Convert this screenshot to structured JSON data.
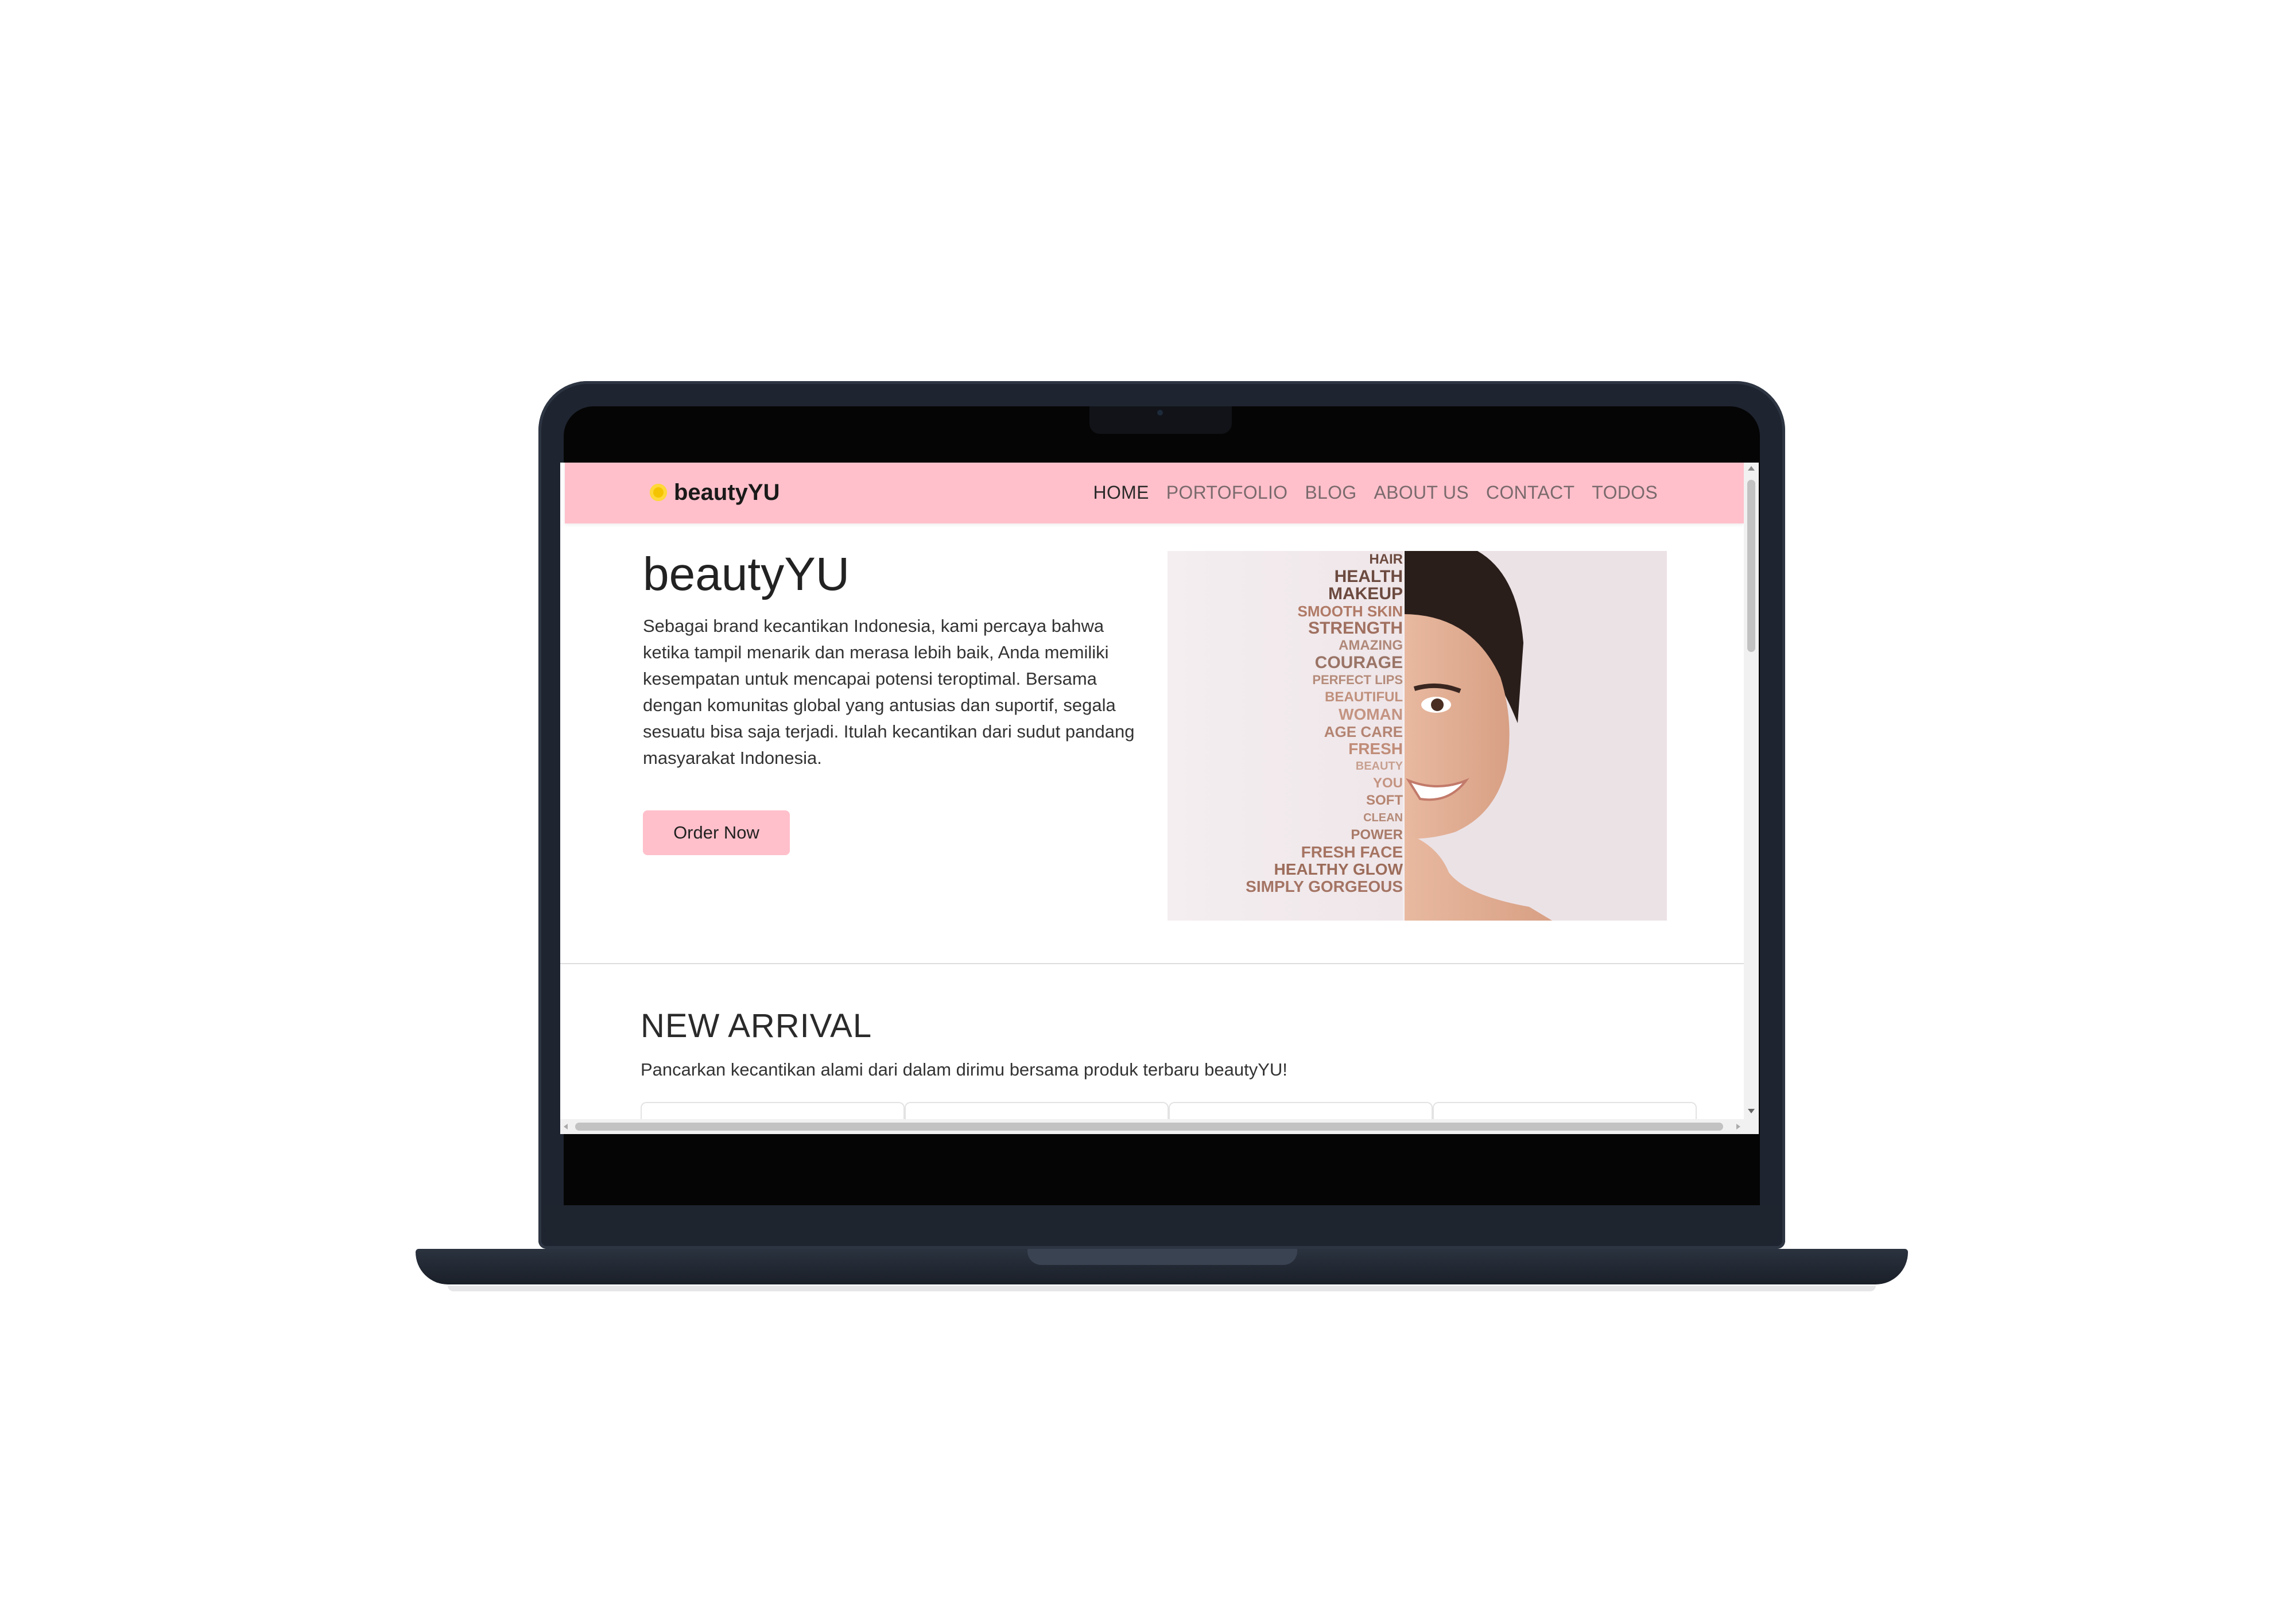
{
  "navbar": {
    "brand": "beautyYU",
    "items": [
      {
        "label": "HOME",
        "active": true
      },
      {
        "label": "PORTOFOLIO",
        "active": false
      },
      {
        "label": "BLOG",
        "active": false
      },
      {
        "label": "ABOUT US",
        "active": false
      },
      {
        "label": "CONTACT",
        "active": false
      },
      {
        "label": "TODOS",
        "active": false
      }
    ]
  },
  "hero": {
    "title": "beautyYU",
    "description": "Sebagai brand kecantikan Indonesia, kami percaya bahwa ketika tampil menarik dan merasa lebih baik, Anda memiliki kesempatan untuk mencapai potensi teroptimal. Bersama dengan komunitas global yang antusias dan suportif, segala sesuatu bisa saja terjadi. Itulah kecantikan dari sudut pandang masyarakat Indonesia.",
    "button_label": "Order Now",
    "image_words": [
      "HAIR",
      "HEALTH",
      "MAKEUP",
      "SMOOTH SKIN",
      "STRENGTH",
      "AMAZING",
      "COURAGE",
      "PERFECT LIPS",
      "BEAUTIFUL",
      "WOMAN",
      "AGE CARE",
      "FRESH",
      "BEAUTY",
      "YOU",
      "SOFT",
      "CLEAN",
      "POWER",
      "FRESH FACE",
      "HEALTHY GLOW",
      "SIMPLY GORGEOUS"
    ]
  },
  "new_arrival": {
    "title": "NEW ARRIVAL",
    "subtitle": "Pancarkan kecantikan alami dari dalam dirimu bersama produk terbaru beautyYU!"
  },
  "colors": {
    "navbar_bg": "#ffc0cb",
    "button_bg": "#ffc0cb",
    "brand_icon": "#f5c400"
  },
  "icons": {
    "brand": "sun-icon"
  }
}
